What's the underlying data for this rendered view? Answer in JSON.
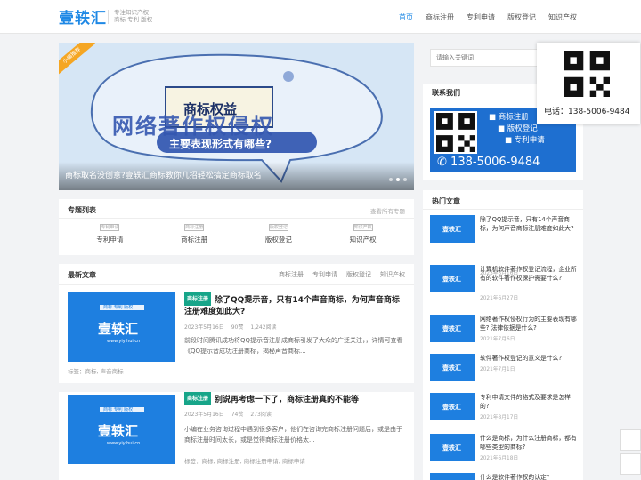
{
  "header": {
    "logo": "壹轶汇",
    "slogan_line1": "专注知识产权",
    "slogan_line2": "商标 专利 版权",
    "nav": [
      "首页",
      "商标注册",
      "专利申请",
      "版权登记",
      "知识产权"
    ]
  },
  "slider": {
    "ribbon": "小编推荐",
    "headline": "网络著作权侵权",
    "sign_text": "商标权益",
    "subline": "主要表现形式有哪些?",
    "caption": "商标取名没创意?壹轶汇商标教你几招轻松搞定商标取名"
  },
  "search": {
    "placeholder": "请输入关键词"
  },
  "qr_popup": {
    "phone": "电话：138-5006-9484"
  },
  "contact": {
    "title": "联系我们",
    "services": [
      "商标注册",
      "版权登记",
      "专利申请"
    ],
    "tel": "138-5006-9484"
  },
  "topics": {
    "title": "专题列表",
    "more": "查看所有专题",
    "items": [
      {
        "icon": "专利申请",
        "label": "专利申请"
      },
      {
        "icon": "商标注册",
        "label": "商标注册"
      },
      {
        "icon": "版权登记",
        "label": "版权登记"
      },
      {
        "icon": "知识产权",
        "label": "知识产权"
      }
    ]
  },
  "latest": {
    "title": "最新文章",
    "tabs": [
      "商标注册",
      "专利申请",
      "版权登记",
      "知识产权"
    ],
    "thumb": {
      "top": "商标 专利 版权",
      "logo": "壹轶汇",
      "url": "www.yiyihui.cn"
    },
    "articles": [
      {
        "tag": "商标注册",
        "title": "除了QQ提示音，只有14个声音商标，为何声音商标注册难度如此大?",
        "date": "2023年5月16日",
        "likes": "90赞",
        "views": "1,242阅读",
        "summary": "前段时间腾讯成功将QQ提示音注册成商标引发了大众的广泛关注，，详情可查看《QQ提示音成功注册商标，揭秘声音商标...",
        "tags": "标签：商标, 声音商标"
      },
      {
        "tag": "商标注册",
        "title": "别说再考虑一下了，商标注册真的不能等",
        "date": "2023年5月16日",
        "likes": "74赞",
        "views": "273阅读",
        "summary": "小编在业务咨询过程中遇到很多客户，他们在咨询完商标注册问题后，或是由于商标注册时间太长，或是觉得商标注册价格太...",
        "tags": "标签：商标, 商标注册, 商标注册申请, 商标申请"
      }
    ]
  },
  "hot": {
    "title": "热门文章",
    "thumb_label": "壹轶汇",
    "items": [
      {
        "title": "除了QQ提示音，只有14个声音商标，为何声音商标注册难度如此大?",
        "date": "2023年5月16日"
      },
      {
        "title": "计算机软件著作权登记流程，企业所有的软件著作权保护需要什么?",
        "date": "2021年6月27日"
      },
      {
        "title": "网络著作权侵权行为的主要表现有哪些? 法律依据是什么?",
        "date": "2021年7月6日"
      },
      {
        "title": "软件著作权登记的意义是什么?",
        "date": "2021年7月1日"
      },
      {
        "title": "专利申请文件的格式及要求是怎样的?",
        "date": "2021年8月17日"
      },
      {
        "title": "什么是商标，为什么注册商标，都有哪些类型的商标?",
        "date": "2021年6月18日"
      },
      {
        "title": "什么是软件著作权的认定?",
        "date": ""
      }
    ]
  }
}
